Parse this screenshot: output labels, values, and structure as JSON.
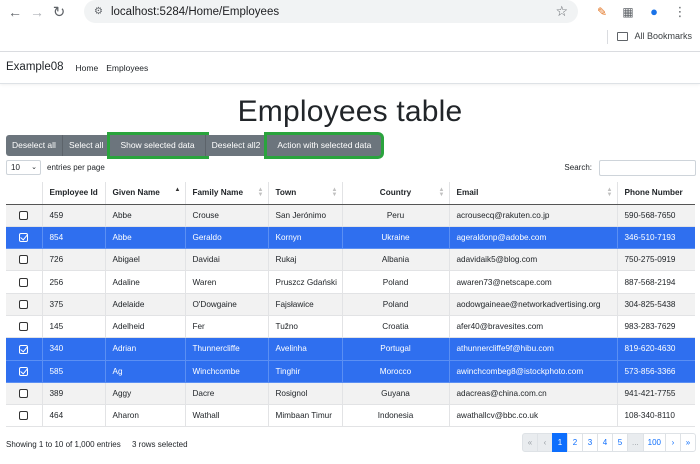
{
  "browser": {
    "url": "localhost:5284/Home/Employees",
    "bookmarks_label": "All Bookmarks"
  },
  "navbar": {
    "brand": "Example08",
    "links": [
      "Home",
      "Employees"
    ]
  },
  "page_title": "Employees table",
  "buttons": [
    "Deselect all",
    "Select all",
    "Show selected data",
    "Deselect all2",
    "Action with selected data"
  ],
  "length": {
    "value": "10",
    "label": "entries per page"
  },
  "search": {
    "label": "Search:"
  },
  "table": {
    "columns": [
      "",
      "Employee Id",
      "Given Name",
      "Family Name",
      "Town",
      "Country",
      "Email",
      "Phone Number"
    ],
    "rows": [
      {
        "selected": false,
        "id": "459",
        "given": "Abbe",
        "family": "Crouse",
        "town": "San Jerónimo",
        "country": "Peru",
        "email": "acrousecq@rakuten.co.jp",
        "phone": "590-568-7650"
      },
      {
        "selected": true,
        "id": "854",
        "given": "Abbe",
        "family": "Geraldo",
        "town": "Kornyn",
        "country": "Ukraine",
        "email": "ageraldonp@adobe.com",
        "phone": "346-510-7193"
      },
      {
        "selected": false,
        "id": "726",
        "given": "Abigael",
        "family": "Davidai",
        "town": "Rukaj",
        "country": "Albania",
        "email": "adavidaik5@blog.com",
        "phone": "750-275-0919"
      },
      {
        "selected": false,
        "id": "256",
        "given": "Adaline",
        "family": "Waren",
        "town": "Pruszcz Gdański",
        "country": "Poland",
        "email": "awaren73@netscape.com",
        "phone": "887-568-2194"
      },
      {
        "selected": false,
        "id": "375",
        "given": "Adelaide",
        "family": "O'Dowgaine",
        "town": "Fajsławice",
        "country": "Poland",
        "email": "aodowgaineae@networkadvertising.org",
        "phone": "304-825-5438"
      },
      {
        "selected": false,
        "id": "145",
        "given": "Adelheid",
        "family": "Fer",
        "town": "Tužno",
        "country": "Croatia",
        "email": "afer40@bravesites.com",
        "phone": "983-283-7629"
      },
      {
        "selected": true,
        "id": "340",
        "given": "Adrian",
        "family": "Thunnercliffe",
        "town": "Avelinha",
        "country": "Portugal",
        "email": "athunnercliffe9f@hibu.com",
        "phone": "819-620-4630"
      },
      {
        "selected": true,
        "id": "585",
        "given": "Ag",
        "family": "Winchcombe",
        "town": "Tinghir",
        "country": "Morocco",
        "email": "awinchcombeg8@istockphoto.com",
        "phone": "573-856-3366"
      },
      {
        "selected": false,
        "id": "389",
        "given": "Aggy",
        "family": "Dacre",
        "town": "Rosignol",
        "country": "Guyana",
        "email": "adacreas@china.com.cn",
        "phone": "941-421-7755"
      },
      {
        "selected": false,
        "id": "464",
        "given": "Aharon",
        "family": "Wathall",
        "town": "Mimbaan Timur",
        "country": "Indonesia",
        "email": "awathallcv@bbc.co.uk",
        "phone": "108-340-8110"
      }
    ]
  },
  "footer": {
    "info": "Showing 1 to 10 of 1,000 entries",
    "selected": "3 rows selected"
  },
  "pagination": [
    "«",
    "‹",
    "1",
    "2",
    "3",
    "4",
    "5",
    "...",
    "100",
    "›",
    "»"
  ]
}
